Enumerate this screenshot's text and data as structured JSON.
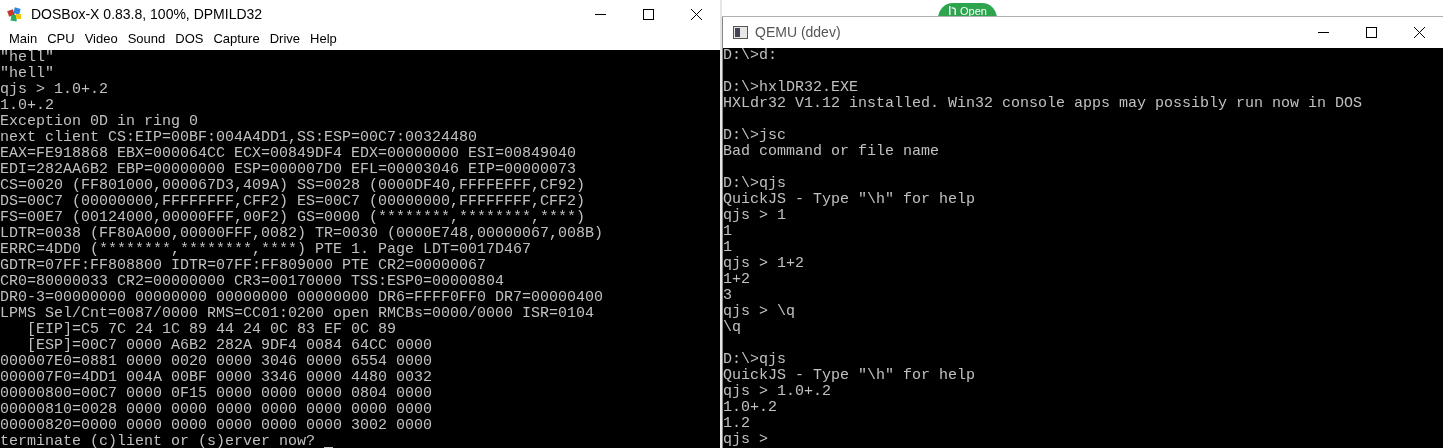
{
  "background_button": {
    "label": "Open"
  },
  "dosbox": {
    "title": "DOSBox-X 0.83.8, 100%, DPMILD32",
    "menu": [
      "Main",
      "CPU",
      "Video",
      "Sound",
      "DOS",
      "Capture",
      "Drive",
      "Help"
    ],
    "console": {
      "cursor": true,
      "blocks": [
        [
          "\"hell\"",
          "\"hell\"",
          "qjs > 1.0+.2",
          "1.0+.2",
          "Exception 0D in ring 0",
          "next client CS:EIP=00BF:004A4DD1,SS:ESP=00C7:00324480",
          "EAX=FE918868 EBX=000064CC ECX=00849DF4 EDX=00000000 ESI=00849040",
          "EDI=282AA6B2 EBP=00000000 ESP=000007D0 EFL=00003046 EIP=00000073",
          "CS=0020 (FF801000,000067D3,409A) SS=0028 (0000DF40,FFFFEFFF,CF92)",
          "DS=00C7 (00000000,FFFFFFFF,CFF2) ES=00C7 (00000000,FFFFFFFF,CFF2)",
          "FS=00E7 (00124000,00000FFF,00F2) GS=0000 (********,********,****)",
          "LDTR=0038 (FF80A000,00000FFF,0082) TR=0030 (0000E748,00000067,008B)",
          "ERRC=4DD0 (********,********,****) PTE 1. Page LDT=0017D467",
          "GDTR=07FF:FF808800 IDTR=07FF:FF809000 PTE CR2=00000067",
          "CR0=80000033 CR2=00000000 CR3=00170000 TSS:ESP0=00000804",
          "DR0-3=00000000 00000000 00000000 00000000 DR6=FFFF0FF0 DR7=00000400",
          "LPMS Sel/Cnt=0087/0000 RMS=CC01:0200 open RMCBs=0000/0000 ISR=0104",
          "   [EIP]=C5 7C 24 1C 89 44 24 0C 83 EF 0C 89",
          "   [ESP]=00C7 0000 A6B2 282A 9DF4 0084 64CC 0000",
          "000007E0=0881 0000 0020 0000 3046 0000 6554 0000",
          "000007F0=4DD1 004A 00BF 0000 3346 0000 4480 0032",
          "00000800=00C7 0000 0F15 0000 0000 0000 0804 0000",
          "00000810=0028 0000 0000 0000 0000 0000 0000 0000",
          "00000820=0000 0000 0000 0000 0000 0000 3002 0000",
          "terminate (c)lient or (s)erver now?"
        ]
      ]
    }
  },
  "qemu": {
    "title": "QEMU (ddev)",
    "console": {
      "blocks": [
        [
          "D:\\>d:"
        ],
        [
          "D:\\>hxlDR32.EXE",
          "HXLdr32 V1.12 installed. Win32 console apps may possibly run now in DOS"
        ],
        [
          "D:\\>jsc",
          "Bad command or file name"
        ],
        [
          "D:\\>qjs",
          "QuickJS - Type \"\\h\" for help",
          "qjs > 1",
          "1",
          "1",
          "qjs > 1+2",
          "1+2",
          "3",
          "qjs > \\q",
          "\\q"
        ],
        [
          "D:\\>qjs",
          "QuickJS - Type \"\\h\" for help",
          "qjs > 1.0+.2",
          "1.0+.2",
          "1.2",
          "qjs >"
        ]
      ]
    }
  }
}
